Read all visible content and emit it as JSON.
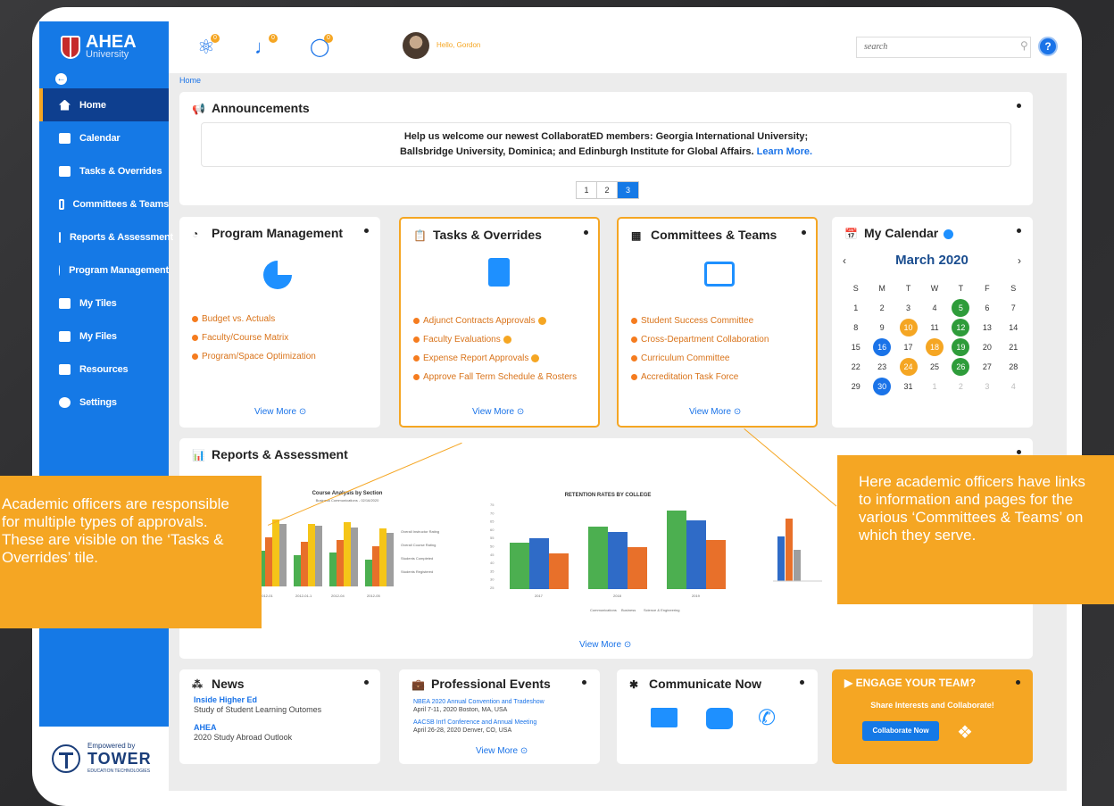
{
  "sidebar": {
    "logo_title": "AHEA",
    "logo_subtitle": "University",
    "items": [
      {
        "label": "Home"
      },
      {
        "label": "Calendar"
      },
      {
        "label": "Tasks & Overrides"
      },
      {
        "label": "Committees & Teams"
      },
      {
        "label": "Reports & Assessment"
      },
      {
        "label": "Program Management"
      },
      {
        "label": "My Tiles"
      },
      {
        "label": "My Files"
      },
      {
        "label": "Resources"
      },
      {
        "label": "Settings"
      }
    ],
    "footer_small": "Empowered by",
    "footer_big": "TOWER",
    "footer_sub": "EDUCATION TECHNOLOGIES"
  },
  "topbar": {
    "badges": [
      "0",
      "0",
      "0"
    ],
    "hello": "Hello, Gordon",
    "search_placeholder": "search",
    "help": "?"
  },
  "breadcrumb": "Home",
  "announcements": {
    "title": "Announcements",
    "line1": "Help us welcome our newest CollaboratED members: Georgia International University;",
    "line2": "Ballsbridge University, Dominica; and Edinburgh Institute for Global Affairs.",
    "learn_more": "Learn More.",
    "pages": [
      "1",
      "2",
      "3"
    ]
  },
  "program_management": {
    "title": "Program Management",
    "links": [
      "Budget vs. Actuals",
      "Faculty/Course Matrix",
      "Program/Space Optimization"
    ],
    "view_more": "View More ⊙"
  },
  "tasks": {
    "title": "Tasks & Overrides",
    "links": [
      "Adjunct Contracts Approvals",
      "Faculty Evaluations",
      "Expense Report Approvals",
      "Approve Fall Term Schedule & Rosters"
    ],
    "view_more": "View More ⊙"
  },
  "committees": {
    "title": "Committees & Teams",
    "links": [
      "Student Success Committee",
      "Cross-Department Collaboration",
      "Curriculum Committee",
      "Accreditation Task Force"
    ],
    "view_more": "View More ⊙"
  },
  "calendar": {
    "title": "My Calendar",
    "month": "March 2020",
    "prev": "‹",
    "next": "›",
    "dow": [
      "S",
      "M",
      "T",
      "W",
      "T",
      "F",
      "S"
    ]
  },
  "reports": {
    "title": "Reports & Assessment",
    "chart1_title": "Course Analysis by Section",
    "chart1_sub": "Business Communications - 02/16/2020",
    "chart1_legend": [
      "Overall Instructor Rating",
      "Overall Course Rating",
      "Students Completed",
      "Students Registered"
    ],
    "chart1_x": [
      "2012-01",
      "2012-01-1",
      "2012-04",
      "2012-05"
    ],
    "chart2_title": "RETENTION RATES BY COLLEGE",
    "chart2_legend": [
      "Communications",
      "Business",
      "Science & Engineering"
    ],
    "chart2_x": [
      "2017",
      "2018",
      "2019"
    ],
    "chart2_y": [
      "75",
      "70",
      "65",
      "60",
      "55",
      "50",
      "45",
      "40",
      "35",
      "30",
      "25"
    ],
    "view_more": "View More ⊙"
  },
  "news": {
    "title": "News",
    "items": [
      {
        "source": "Inside Higher Ed",
        "text": "Study of Student Learning Outomes"
      },
      {
        "source": "AHEA",
        "text": "2020 Study Abroad Outlook"
      }
    ]
  },
  "events": {
    "title": "Professional Events",
    "items": [
      {
        "name": "NBEA 2020 Annual Convention and Tradeshow",
        "date": "April 7-11, 2020 Boston, MA, USA"
      },
      {
        "name": "AACSB Int'l Conference and Annual Meeting",
        "date": "April 26-28, 2020 Denver, CO, USA"
      }
    ],
    "view_more": "View More ⊙"
  },
  "communicate": {
    "title": "Communicate Now"
  },
  "engage": {
    "title": "ENGAGE YOUR TEAM?",
    "sub": "Share Interests and Collaborate!",
    "button": "Collaborate Now"
  },
  "callouts": {
    "left": "Academic officers are responsible for multiple types of approvals. These are visible on the ‘Tasks & Overrides’ tile.",
    "right": "Here academic officers have links to information and pages for the various ‘Committees & Teams’ on which they serve."
  },
  "colors": {
    "accent": "#1579e6",
    "highlight": "#f5a623",
    "navy": "#0e3f8f"
  }
}
